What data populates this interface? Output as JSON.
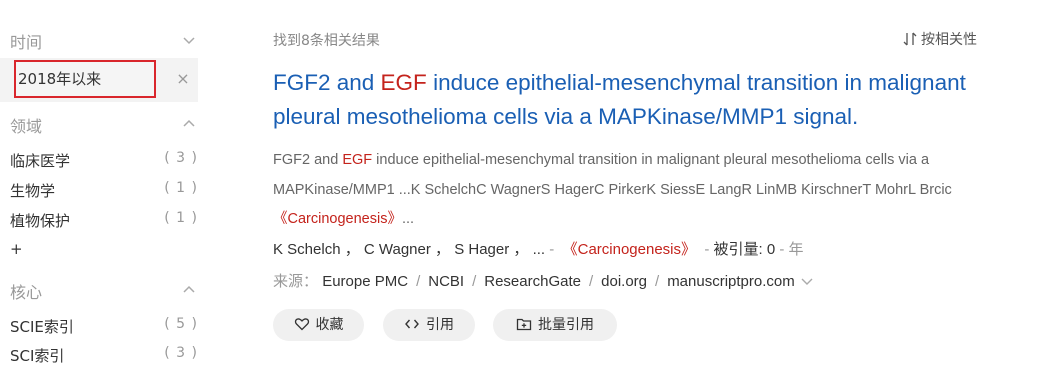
{
  "sidebar": {
    "time": {
      "label": "时间",
      "icon": "chevron-down-icon",
      "selected_value": "2018年以来",
      "clear_glyph": "×"
    },
    "field": {
      "label": "领域",
      "icon": "chevron-up-icon",
      "items": [
        {
          "label": "临床医学",
          "count": "( 3 )"
        },
        {
          "label": "生物学",
          "count": "( 1 )"
        },
        {
          "label": "植物保护",
          "count": "( 1 )"
        }
      ],
      "more": "+"
    },
    "core": {
      "label": "核心",
      "icon": "chevron-up-icon",
      "items": [
        {
          "label": "SCIE索引",
          "count": "( 5 )"
        },
        {
          "label": "SCI索引",
          "count": "( 3 )"
        }
      ]
    }
  },
  "results": {
    "count_text": "找到8条相关结果",
    "sort_label": "按相关性",
    "item": {
      "title_pre": "FGF2 and ",
      "title_hl": "EGF",
      "title_post": " induce epithelial-mesenchymal transition in malignant pleural mesothelioma cells via a MAPKinase/MMP1 signal.",
      "abstract_pre": "FGF2 and ",
      "abstract_hl": "EGF",
      "abstract_post": " induce epithelial-mesenchymal transition in malignant pleural mesothelioma cells via a MAPKinase/MMP1 ...K SchelchC WagnerS HagerC PirkerK SiessE LangR LinMB KirschnerT MohrL Brcic",
      "abstract_journal": "《Carcinogenesis》",
      "abstract_tail": "...",
      "authors": [
        "K Schelch",
        "C Wagner",
        "S Hager",
        "..."
      ],
      "author_sep": " ，",
      "dash": "-",
      "journal": "《Carcinogenesis》",
      "cited_label": "被引量:",
      "cited_value": "0",
      "year_label": "年",
      "source_label": "来源：",
      "sources": [
        "Europe PMC",
        "NCBI",
        "ResearchGate",
        "doi.org",
        "manuscriptpro.com"
      ],
      "source_sep": "/",
      "actions": {
        "favorite": "收藏",
        "cite": "引用",
        "batch_cite": "批量引用"
      }
    }
  },
  "colors": {
    "accent": "#d9262c",
    "link": "#1a5fb4",
    "highlight": "#c4231c"
  }
}
